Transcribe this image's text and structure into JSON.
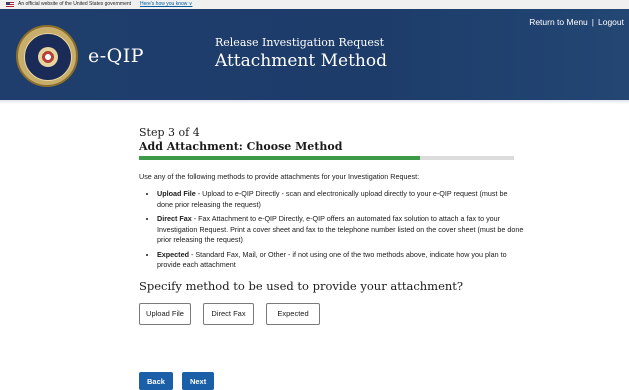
{
  "gov_banner": {
    "text": "An official website of the United States government",
    "link": "Here's how you know ∨"
  },
  "header": {
    "brand": "e-QIP",
    "subtitle": "Release Investigation Request",
    "title": "Attachment Method",
    "return_link": "Return to Menu",
    "separator": "|",
    "logout_link": "Logout"
  },
  "step": {
    "number_label": "Step 3 of 4",
    "title": "Add Attachment: Choose Method",
    "progress_fraction": 0.75
  },
  "intro": "Use any of the following methods to provide attachments for your Investigation Request:",
  "methods": [
    {
      "name": "Upload File",
      "description": " - Upload to e-QIP Directly - scan and electronically upload directly to your e-QIP request (must be done prior releasing the request)"
    },
    {
      "name": "Direct Fax",
      "description": " - Fax Attachment to e-QIP Directly, e-QIP offers an automated fax solution to attach a fax to your Investigation Request. Print a cover sheet and fax to the telephone number listed on the cover sheet (must be done prior releasing the request)"
    },
    {
      "name": "Expected",
      "description": " - Standard Fax, Mail, or Other - if not using one of the two methods above, indicate how you plan to provide each attachment"
    }
  ],
  "question": "Specify method to be used to provide your attachment?",
  "buttons": {
    "upload": "Upload File",
    "fax": "Direct Fax",
    "expected": "Expected",
    "back": "Back",
    "next": "Next"
  },
  "colors": {
    "header_bg": "#1f3e6d",
    "progress_fill": "#3d9a48",
    "primary_button": "#1a5fa8"
  }
}
